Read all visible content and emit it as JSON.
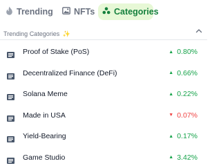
{
  "tabs": [
    {
      "label": "Trending",
      "icon": "flame-icon",
      "active": false
    },
    {
      "label": "NFTs",
      "icon": "image-icon",
      "active": false
    },
    {
      "label": "Categories",
      "icon": "category-icon",
      "active": true
    }
  ],
  "section": {
    "title": "Trending Categories",
    "icon": "sparkle-icon",
    "collapse_icon": "chevron-up-icon"
  },
  "colors": {
    "active_tab_bg": "#e7f8d6",
    "active_tab_text": "#15803d",
    "positive": "#16a34a",
    "negative": "#ef4444"
  },
  "categories": [
    {
      "name": "Proof of Stake (PoS)",
      "change": "0.80%",
      "direction": "up"
    },
    {
      "name": "Decentralized Finance (DeFi)",
      "change": "0.66%",
      "direction": "up"
    },
    {
      "name": "Solana Meme",
      "change": "0.22%",
      "direction": "up"
    },
    {
      "name": "Made in USA",
      "change": "0.07%",
      "direction": "down"
    },
    {
      "name": "Yield-Bearing",
      "change": "0.17%",
      "direction": "up"
    },
    {
      "name": "Game Studio",
      "change": "3.42%",
      "direction": "up"
    }
  ]
}
